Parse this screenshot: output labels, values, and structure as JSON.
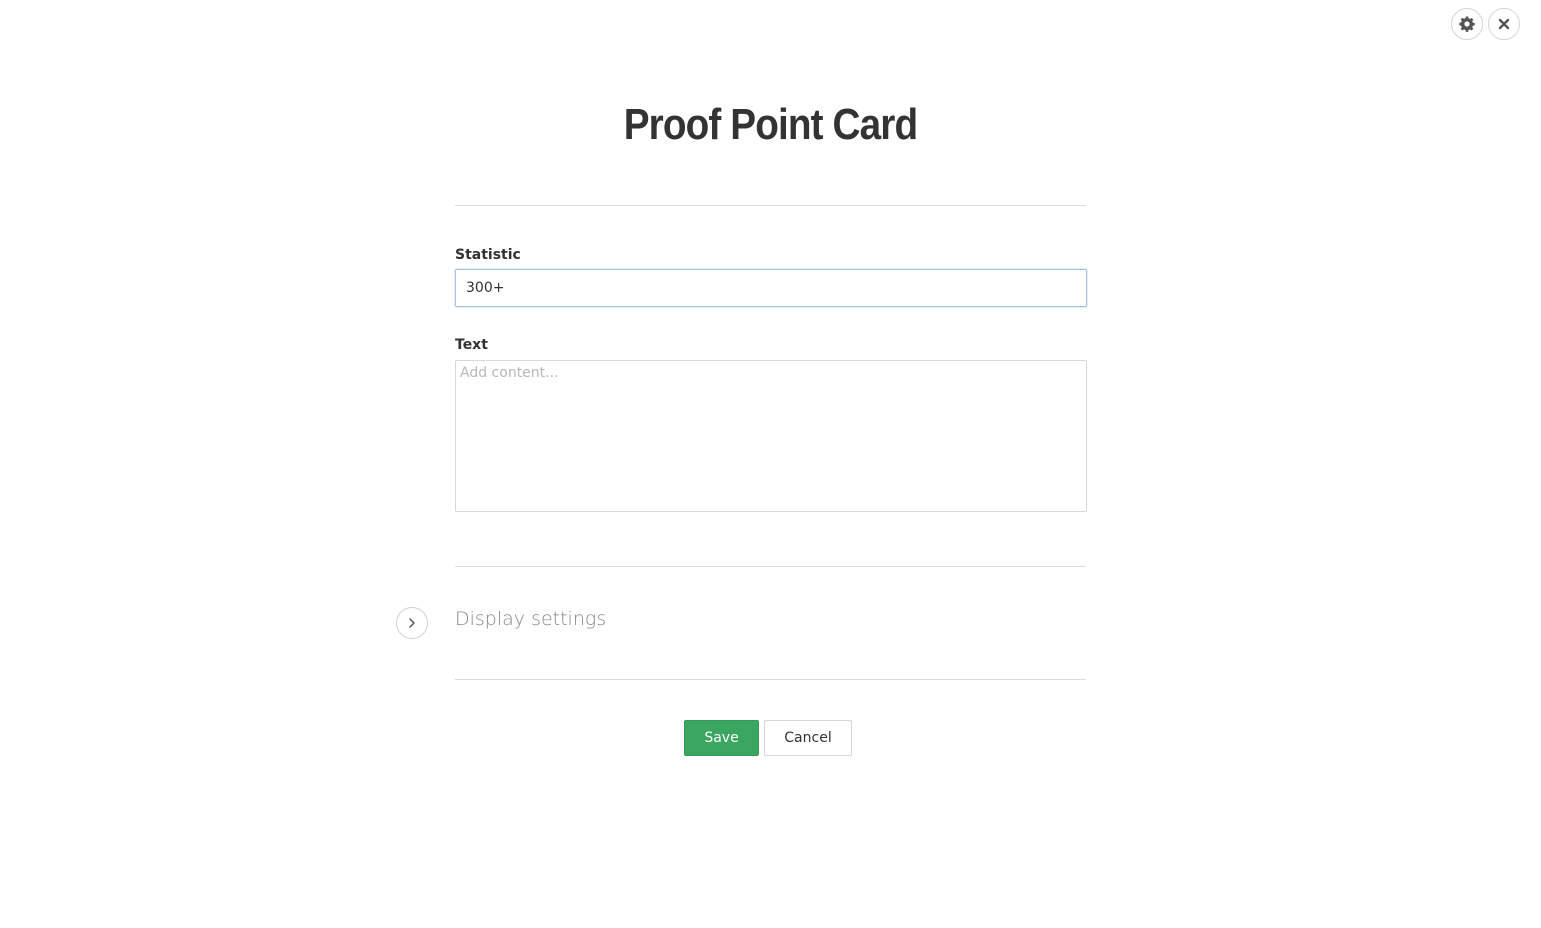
{
  "header": {
    "settings_icon": "gear-icon",
    "close_icon": "close-icon"
  },
  "title": "Proof Point Card",
  "fields": {
    "statistic": {
      "label": "Statistic",
      "value": "300+"
    },
    "text": {
      "label": "Text",
      "value": "",
      "placeholder": "Add content..."
    }
  },
  "display_settings": {
    "label": "Display settings",
    "icon": "chevron-right-icon",
    "expanded": false
  },
  "actions": {
    "save_label": "Save",
    "cancel_label": "Cancel"
  },
  "colors": {
    "primary": "#3aa660",
    "text": "#333333",
    "muted": "#888888",
    "focus_border": "#a9c3dd"
  }
}
